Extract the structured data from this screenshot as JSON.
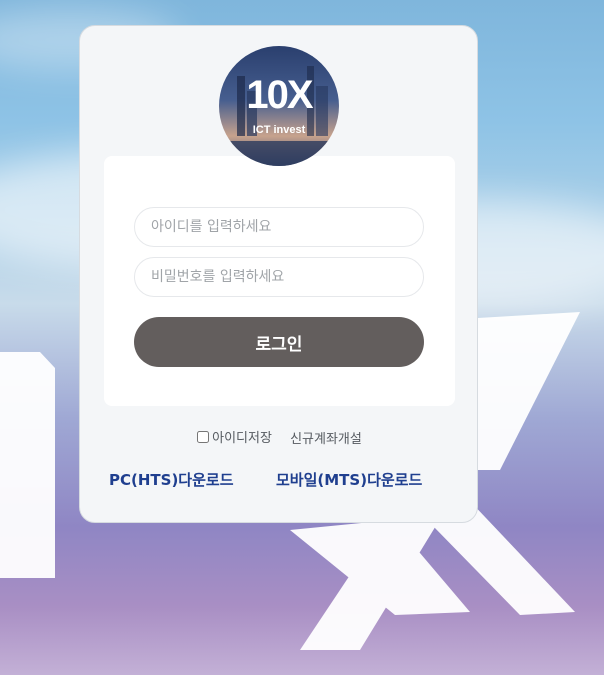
{
  "logo": {
    "main_text": "10X",
    "sub_text": "ICT invest"
  },
  "form": {
    "id_placeholder": "아이디를 입력하세요",
    "pw_placeholder": "비밀번호를 입력하세요",
    "login_label": "로그인"
  },
  "options": {
    "save_id_label": "아이디저장",
    "signup_label": "신규계좌개설"
  },
  "downloads": {
    "pc_label": "PC(HTS)다운로드",
    "mobile_label": "모바일(MTS)다운로드"
  },
  "colors": {
    "login_button": "#635e5d",
    "download_link": "#1f3f8f",
    "card_bg": "#f4f6f8"
  }
}
